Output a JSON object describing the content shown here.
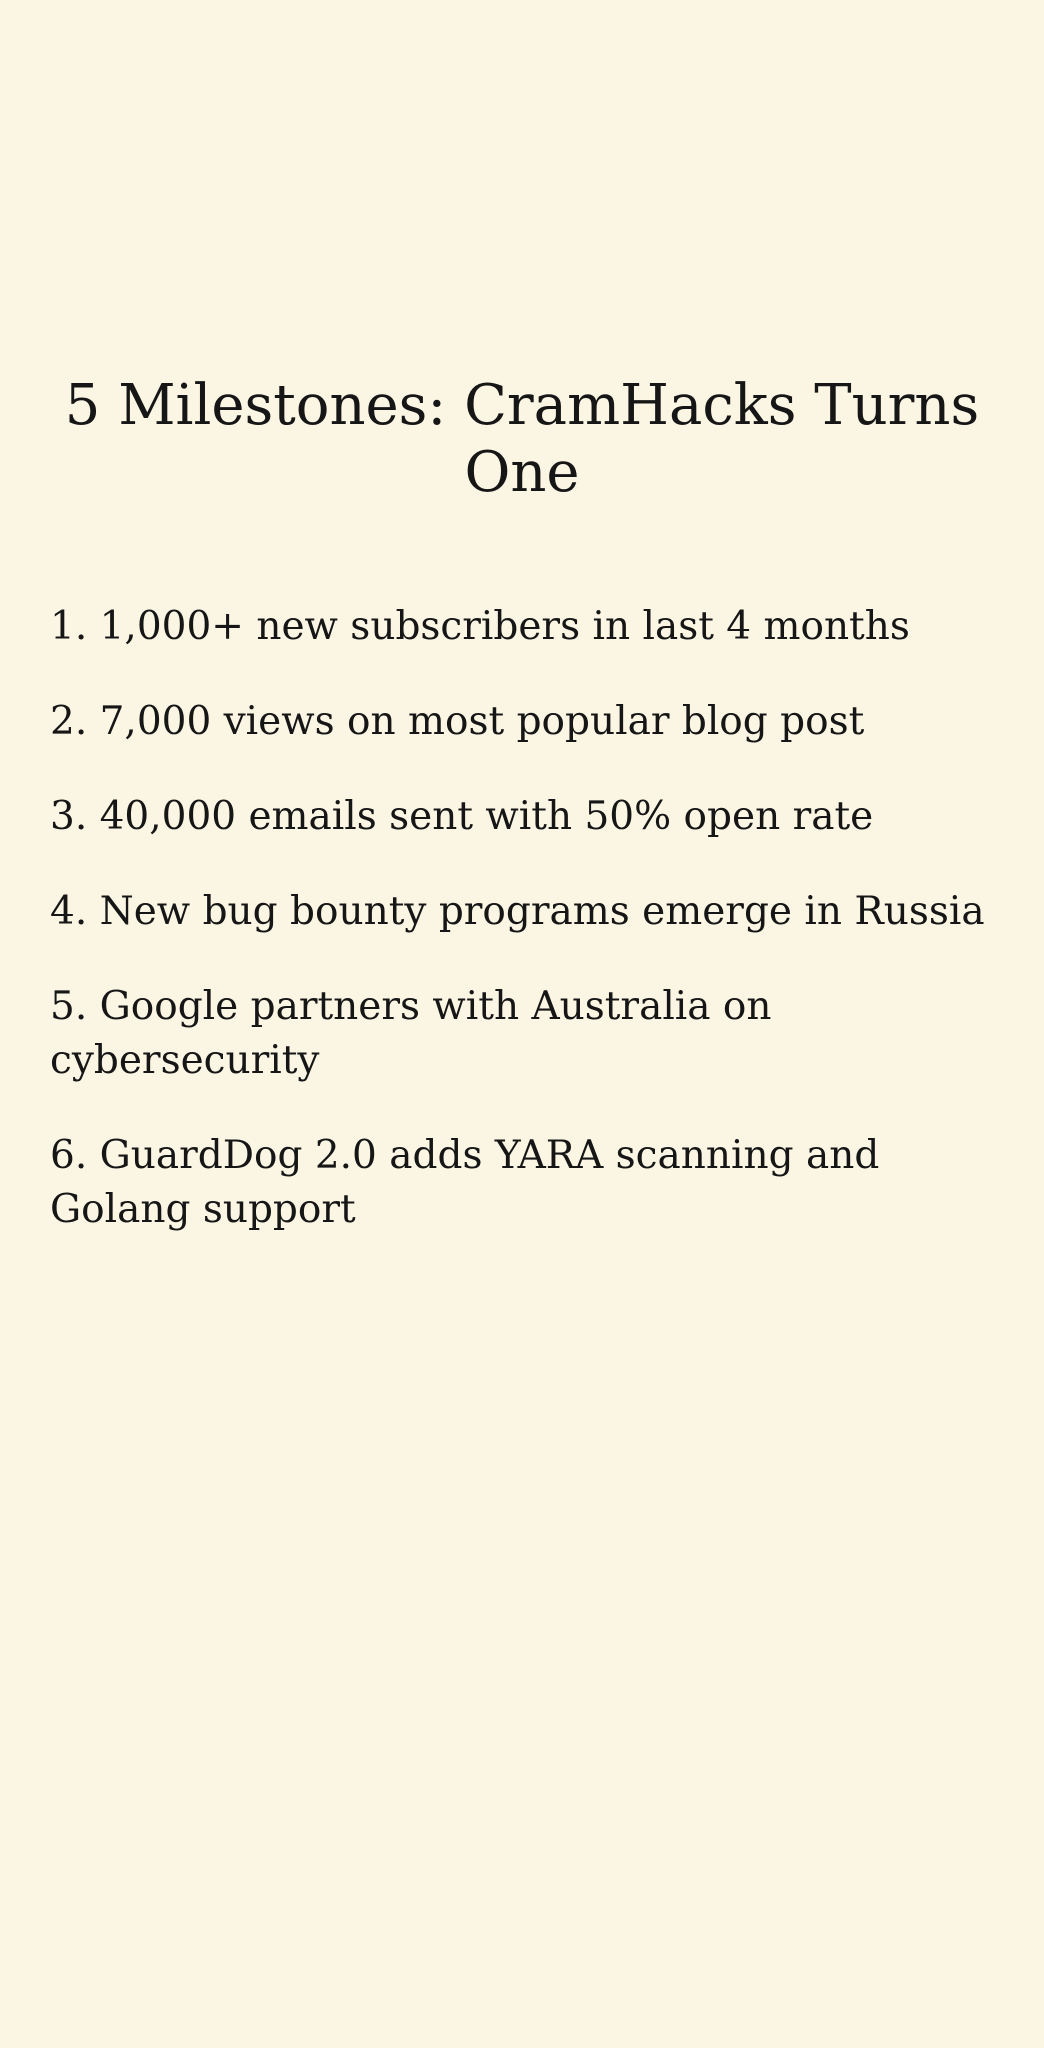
{
  "page": {
    "background_color": "#fbf5e4",
    "text_color": "#161616"
  },
  "title": "5 Milestones: CramHacks Turns One",
  "milestones": [
    "1. 1,000+ new subscribers in last 4 months",
    "2. 7,000 views on most popular blog post",
    "3. 40,000 emails sent with 50% open rate",
    "4. New bug bounty programs emerge in Russia",
    "5. Google partners with Australia on cybersecurity",
    "6. GuardDog 2.0 adds YARA scanning and Golang support"
  ]
}
